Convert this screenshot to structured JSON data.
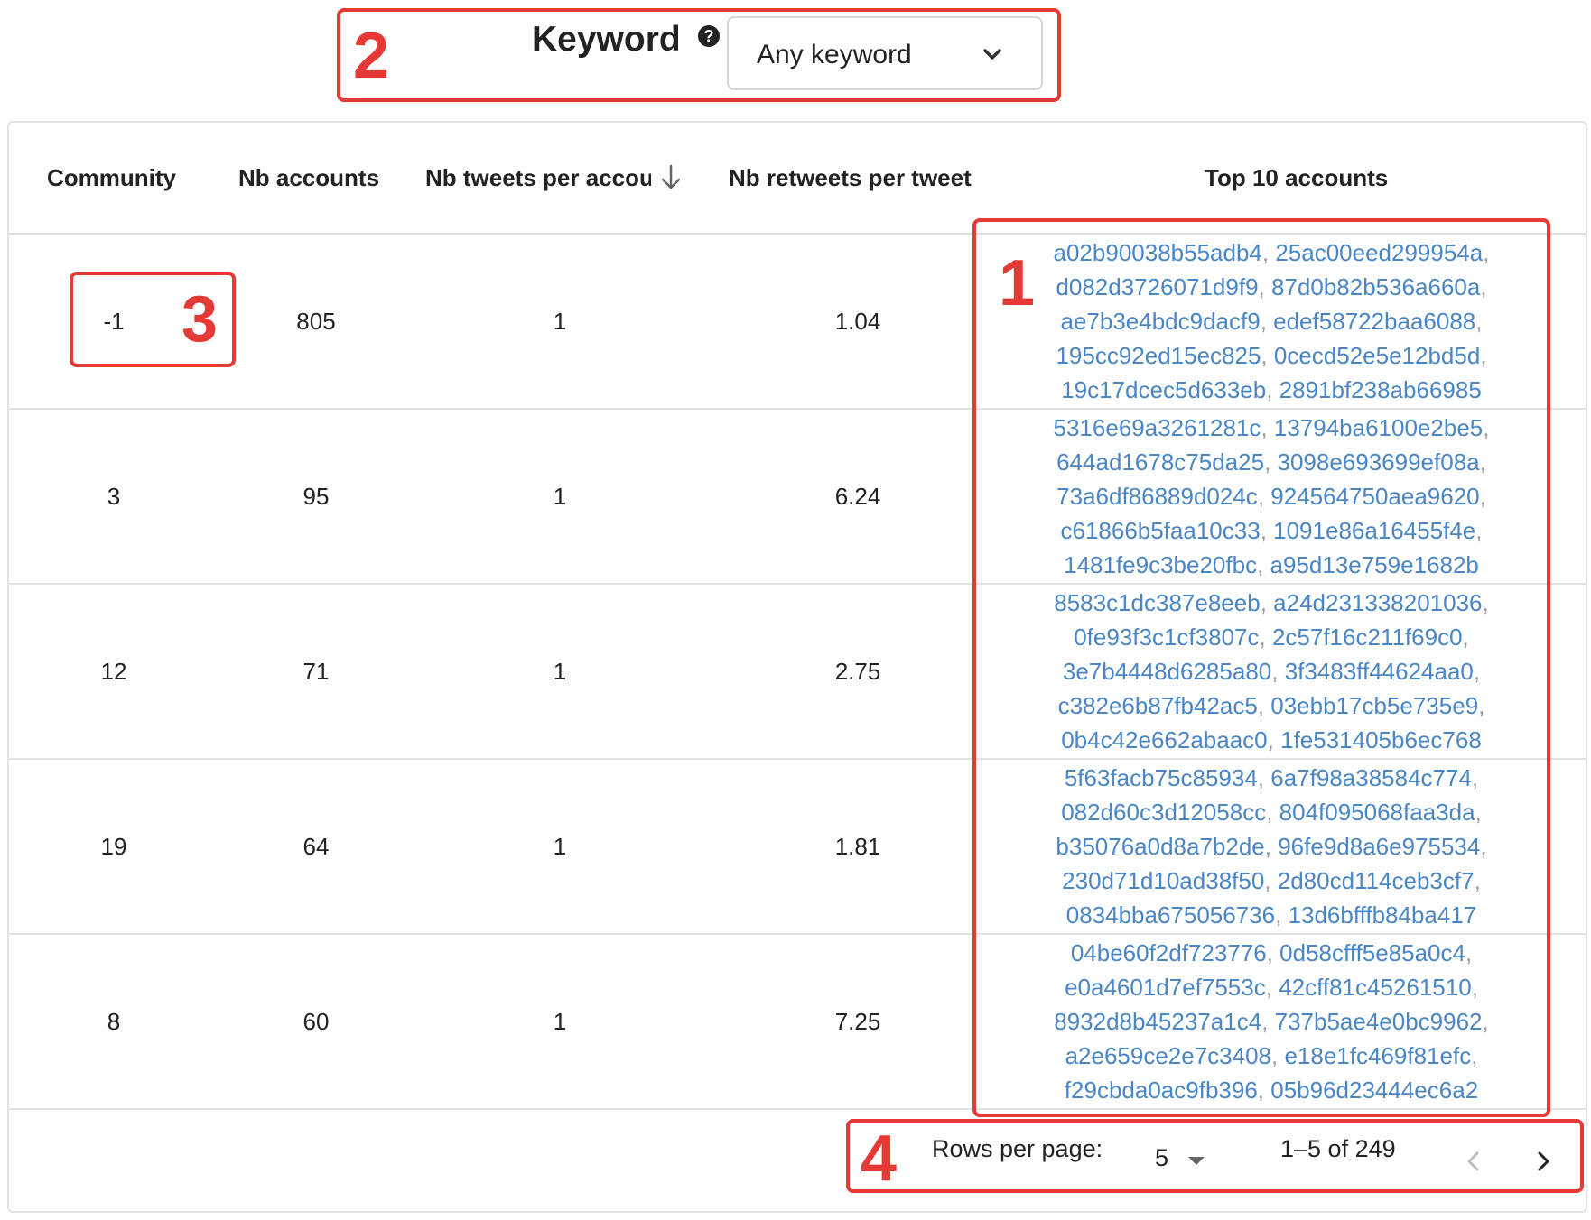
{
  "filter": {
    "label": "Keyword",
    "help_icon": "?",
    "selected": "Any keyword"
  },
  "table": {
    "headers": {
      "community": "Community",
      "nb_accounts": "Nb accounts",
      "nb_tweets": "Nb tweets per account",
      "nb_retweets": "Nb retweets per tweet",
      "top_accounts": "Top 10 accounts"
    },
    "rows": [
      {
        "community": "-1",
        "nb_accounts": "805",
        "nb_tweets": "1",
        "nb_retweets": "1.04",
        "accounts": [
          "a02b90038b55adb4",
          "25ac00eed299954a",
          "d082d3726071d9f9",
          "87d0b82b536a660a",
          "ae7b3e4bdc9dacf9",
          "edef58722baa6088",
          "195cc92ed15ec825",
          "0cecd52e5e12bd5d",
          "19c17dcec5d633eb",
          "2891bf238ab66985"
        ]
      },
      {
        "community": "3",
        "nb_accounts": "95",
        "nb_tweets": "1",
        "nb_retweets": "6.24",
        "accounts": [
          "5316e69a3261281c",
          "13794ba6100e2be5",
          "644ad1678c75da25",
          "3098e693699ef08a",
          "73a6df86889d024c",
          "924564750aea9620",
          "c61866b5faa10c33",
          "1091e86a16455f4e",
          "1481fe9c3be20fbc",
          "a95d13e759e1682b"
        ]
      },
      {
        "community": "12",
        "nb_accounts": "71",
        "nb_tweets": "1",
        "nb_retweets": "2.75",
        "accounts": [
          "8583c1dc387e8eeb",
          "a24d231338201036",
          "0fe93f3c1cf3807c",
          "2c57f16c211f69c0",
          "3e7b4448d6285a80",
          "3f3483ff44624aa0",
          "c382e6b87fb42ac5",
          "03ebb17cb5e735e9",
          "0b4c42e662abaac0",
          "1fe531405b6ec768"
        ]
      },
      {
        "community": "19",
        "nb_accounts": "64",
        "nb_tweets": "1",
        "nb_retweets": "1.81",
        "accounts": [
          "5f63facb75c85934",
          "6a7f98a38584c774",
          "082d60c3d12058cc",
          "804f095068faa3da",
          "b35076a0d8a7b2de",
          "96fe9d8a6e975534",
          "230d71d10ad38f50",
          "2d80cd114ceb3cf7",
          "0834bba675056736",
          "13d6bfffb84ba417"
        ]
      },
      {
        "community": "8",
        "nb_accounts": "60",
        "nb_tweets": "1",
        "nb_retweets": "7.25",
        "accounts": [
          "04be60f2df723776",
          "0d58cfff5e85a0c4",
          "e0a4601d7ef7553c",
          "42cff81c45261510",
          "8932d8b45237a1c4",
          "737b5ae4e0bc9962",
          "a2e659ce2e7c3408",
          "e18e1fc469f81efc",
          "f29cbda0ac9fb396",
          "05b96d23444ec6a2"
        ]
      }
    ]
  },
  "pagination": {
    "rows_per_page_label": "Rows per page:",
    "rows_per_page_value": "5",
    "range": "1–5 of 249"
  },
  "annotations": [
    "1",
    "2",
    "3",
    "4"
  ],
  "colors": {
    "annotation": "#e53935",
    "link": "#4a86c5"
  }
}
